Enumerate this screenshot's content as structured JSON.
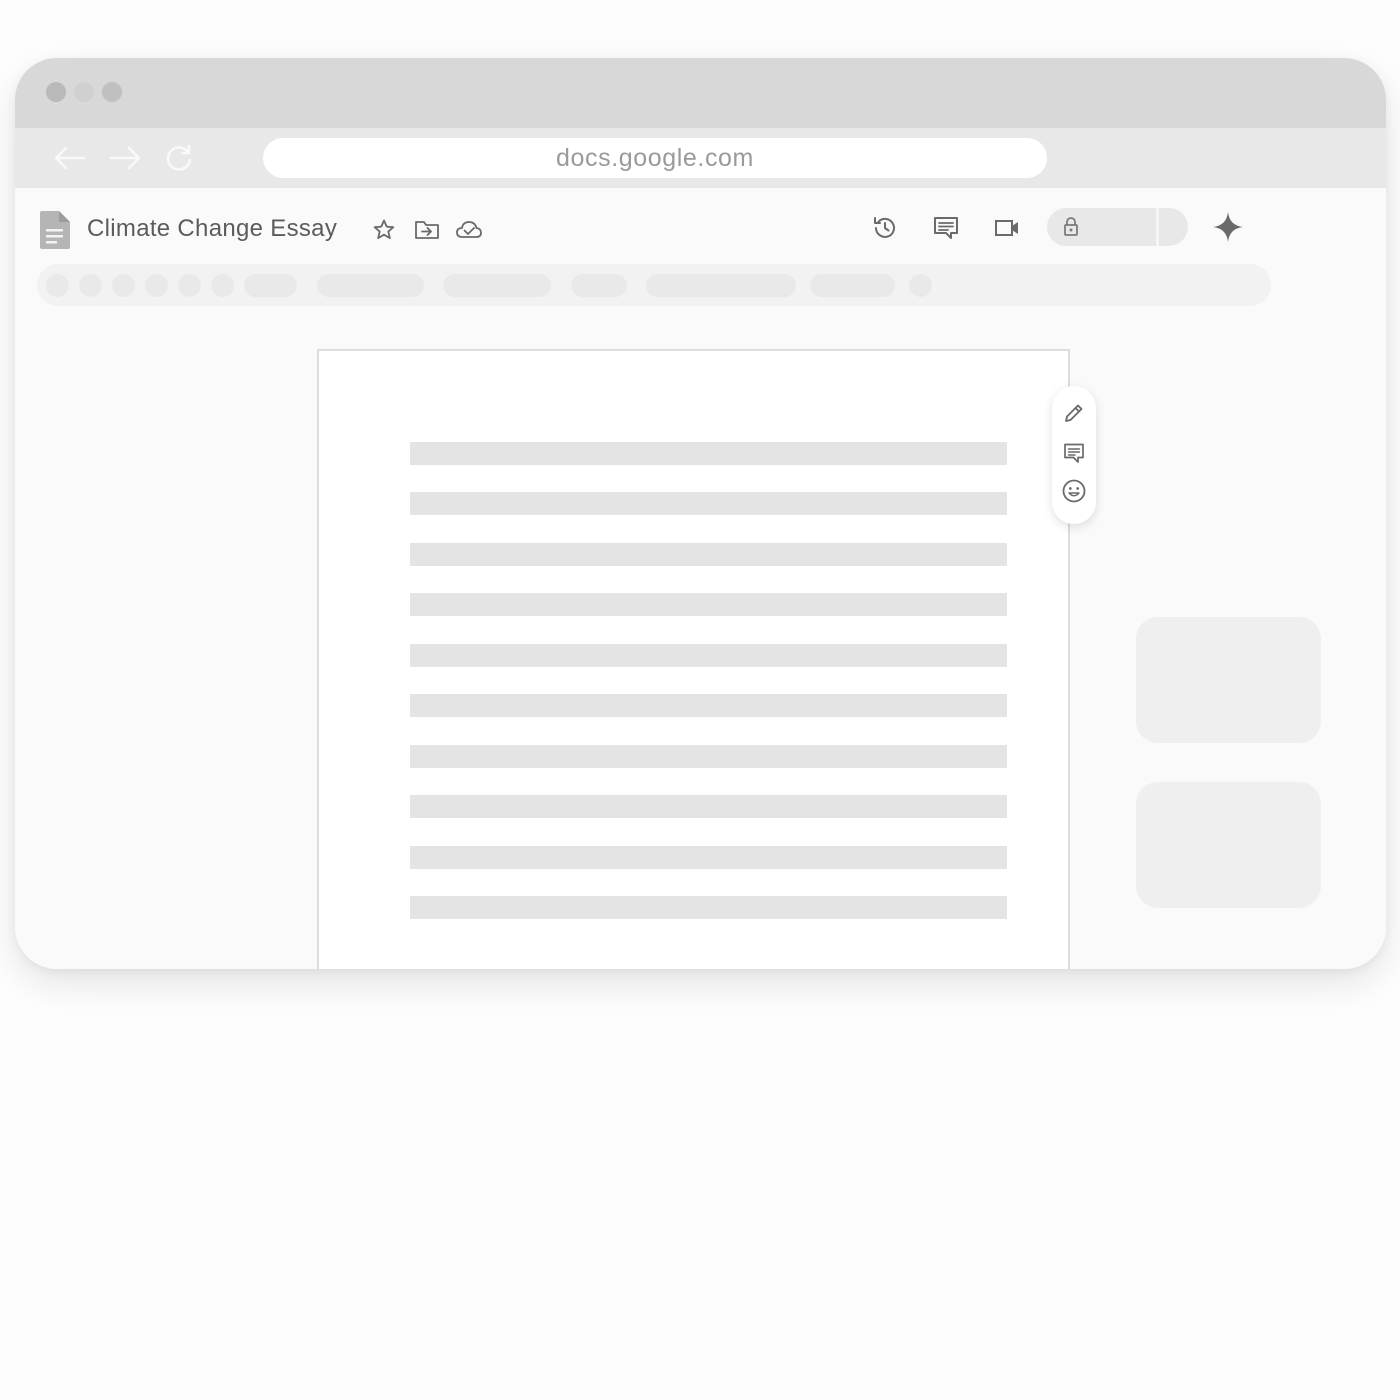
{
  "browser": {
    "url": "docs.google.com",
    "icons": {
      "back": "arrow-left-icon",
      "forward": "arrow-right-icon",
      "reload": "reload-icon"
    }
  },
  "document": {
    "title": "Climate Change Essay",
    "title_icons": [
      "star-icon",
      "move-to-folder-icon",
      "cloud-saved-icon"
    ],
    "header_icons": [
      "version-history-icon",
      "comments-icon",
      "meet-video-icon",
      "lock-icon",
      "gemini-sparkle-icon"
    ],
    "floating_menu_icons": [
      "edit-icon",
      "add-comment-icon",
      "emoji-reaction-icon"
    ]
  },
  "colors": {
    "titlebar": "#d8d8d8",
    "navbar": "#e8e8e8",
    "placeholder_line": "#e4e4e4",
    "icon": "#6a6a6a"
  }
}
